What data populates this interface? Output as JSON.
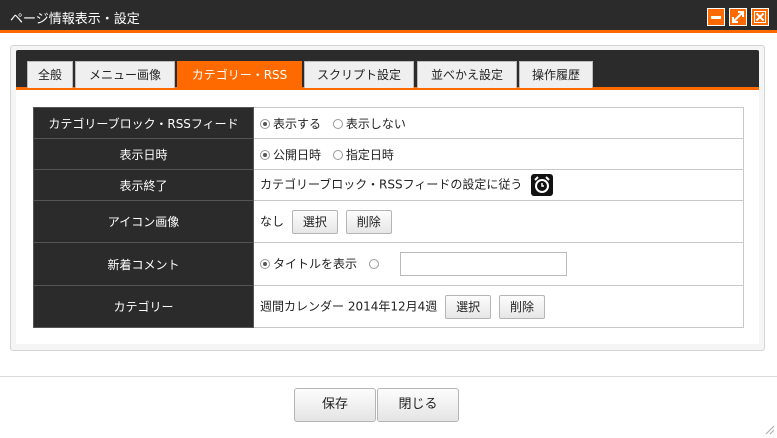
{
  "window": {
    "title": "ページ情報表示・設定"
  },
  "tabs": [
    {
      "label": "全般"
    },
    {
      "label": "メニュー画像"
    },
    {
      "label": "カテゴリー・RSS"
    },
    {
      "label": "スクリプト設定"
    },
    {
      "label": "並べかえ設定"
    },
    {
      "label": "操作履歴"
    }
  ],
  "active_tab": "カテゴリー・RSS",
  "rows": {
    "feed": {
      "label": "カテゴリーブロック・RSSフィード",
      "opt_show": "表示する",
      "opt_hide": "表示しない"
    },
    "date": {
      "label": "表示日時",
      "opt_publish": "公開日時",
      "opt_specified": "指定日時"
    },
    "end": {
      "label": "表示終了",
      "value": "カテゴリーブロック・RSSフィードの設定に従う"
    },
    "icon": {
      "label": "アイコン画像",
      "value": "なし",
      "select": "選択",
      "delete": "削除"
    },
    "comment": {
      "label": "新着コメント",
      "opt_title": "タイトルを表示",
      "input_value": ""
    },
    "category": {
      "label": "カテゴリー",
      "value": "週間カレンダー 2014年12月4週",
      "select": "選択",
      "delete": "削除"
    }
  },
  "footer": {
    "save": "保存",
    "close": "閉じる"
  },
  "colors": {
    "accent": "#ff6a00",
    "dark": "#2b2b2b"
  }
}
